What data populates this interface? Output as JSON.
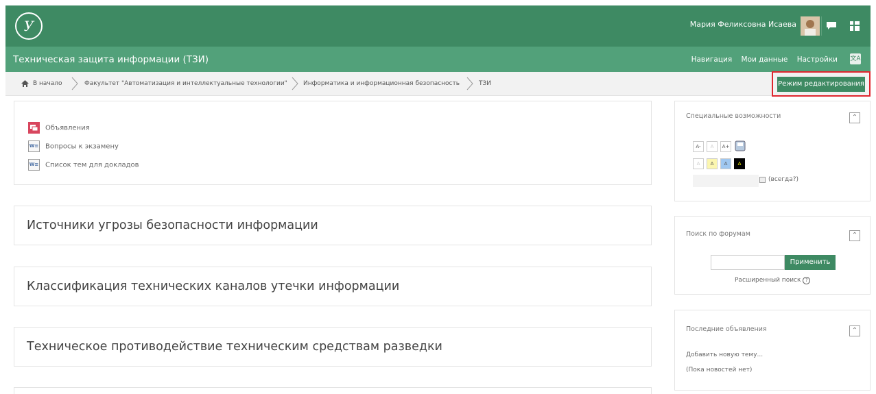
{
  "header": {
    "logo_text": "У",
    "user_name": "Мария Феликсовна Исаева",
    "icons": [
      "avatar",
      "clock-icon",
      "chat-icon",
      "grid-icon"
    ]
  },
  "course": {
    "title": "Техническая защита информации (ТЗИ)",
    "nav": [
      "Навигация",
      "Мои данные",
      "Настройки"
    ]
  },
  "breadcrumb": {
    "items": [
      "В начало",
      "Факультет \"Автоматизация и интеллектуальные технологии\"",
      "Информатика и информационная безопасность",
      "ТЗИ"
    ],
    "edit_button": "Режим редактирования"
  },
  "main": {
    "activities": [
      {
        "label": "Объявления",
        "icon": "forum-icon"
      },
      {
        "label": "Вопросы к экзамену",
        "icon": "word-doc-icon"
      },
      {
        "label": "Список тем для докладов",
        "icon": "word-doc-icon"
      }
    ],
    "sections": [
      "Источники угрозы безопасности информации",
      "Классификация технических каналов утечки информации",
      "Техническое противодействие техническим средствам разведки"
    ]
  },
  "blocks": {
    "accessibility": {
      "title": "Специальные возможности",
      "row1": [
        "A-",
        "A",
        "A+"
      ],
      "row2": [
        "A",
        "A",
        "A",
        "A"
      ],
      "always_label": "(всегда?)"
    },
    "forum_search": {
      "title": "Поиск по форумам",
      "button": "Применить",
      "advanced": "Расширенный поиск"
    },
    "news": {
      "title": "Последние объявления",
      "add_topic": "Добавить новую тему...",
      "no_news": "(Пока новостей нет)"
    }
  },
  "colors": {
    "header": "#3e8a63",
    "course_bar": "#52a17a",
    "highlight": "#e0262e"
  }
}
